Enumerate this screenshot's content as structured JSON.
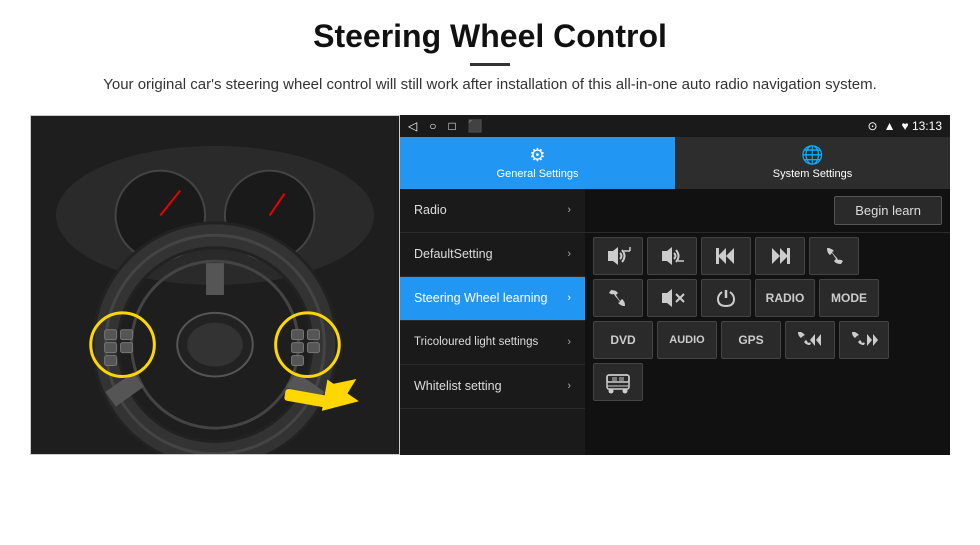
{
  "header": {
    "title": "Steering Wheel Control",
    "divider": true,
    "description": "Your original car's steering wheel control will still work after installation of this all-in-one auto radio navigation system."
  },
  "status_bar": {
    "nav_icons": [
      "◁",
      "○",
      "□",
      "⬛"
    ],
    "right_info": "♥  13:13",
    "location_icon": "⊙"
  },
  "tabs": [
    {
      "id": "general",
      "label": "General Settings",
      "icon": "⚙",
      "active": true
    },
    {
      "id": "system",
      "label": "System Settings",
      "icon": "🌐",
      "active": false
    }
  ],
  "menu_items": [
    {
      "id": "radio",
      "label": "Radio",
      "active": false
    },
    {
      "id": "default",
      "label": "DefaultSetting",
      "active": false
    },
    {
      "id": "steering",
      "label": "Steering Wheel learning",
      "active": true
    },
    {
      "id": "tricoloured",
      "label": "Tricoloured light settings",
      "active": false
    },
    {
      "id": "whitelist",
      "label": "Whitelist setting",
      "active": false
    }
  ],
  "right_panel": {
    "begin_learn_label": "Begin learn",
    "control_rows": [
      [
        {
          "icon": "🔊+",
          "type": "icon",
          "label": "vol-up"
        },
        {
          "icon": "🔊-",
          "type": "icon",
          "label": "vol-down"
        },
        {
          "icon": "⏮",
          "type": "icon",
          "label": "prev"
        },
        {
          "icon": "⏭",
          "type": "icon",
          "label": "next"
        },
        {
          "icon": "📞",
          "type": "icon",
          "label": "phone"
        }
      ],
      [
        {
          "icon": "↩",
          "type": "icon",
          "label": "back"
        },
        {
          "icon": "🔇",
          "type": "icon",
          "label": "mute"
        },
        {
          "icon": "⏻",
          "type": "icon",
          "label": "power"
        },
        {
          "text": "RADIO",
          "type": "text",
          "label": "radio-btn"
        },
        {
          "text": "MODE",
          "type": "text",
          "label": "mode-btn"
        }
      ],
      [
        {
          "text": "DVD",
          "type": "text",
          "label": "dvd-btn"
        },
        {
          "text": "AUDIO",
          "type": "text",
          "label": "audio-btn"
        },
        {
          "text": "GPS",
          "type": "text",
          "label": "gps-btn"
        },
        {
          "icon": "📞⏮",
          "type": "icon",
          "label": "phone-prev"
        },
        {
          "icon": "⏭📞",
          "type": "icon",
          "label": "phone-next"
        }
      ]
    ],
    "whitelist_icon": "🚌"
  }
}
